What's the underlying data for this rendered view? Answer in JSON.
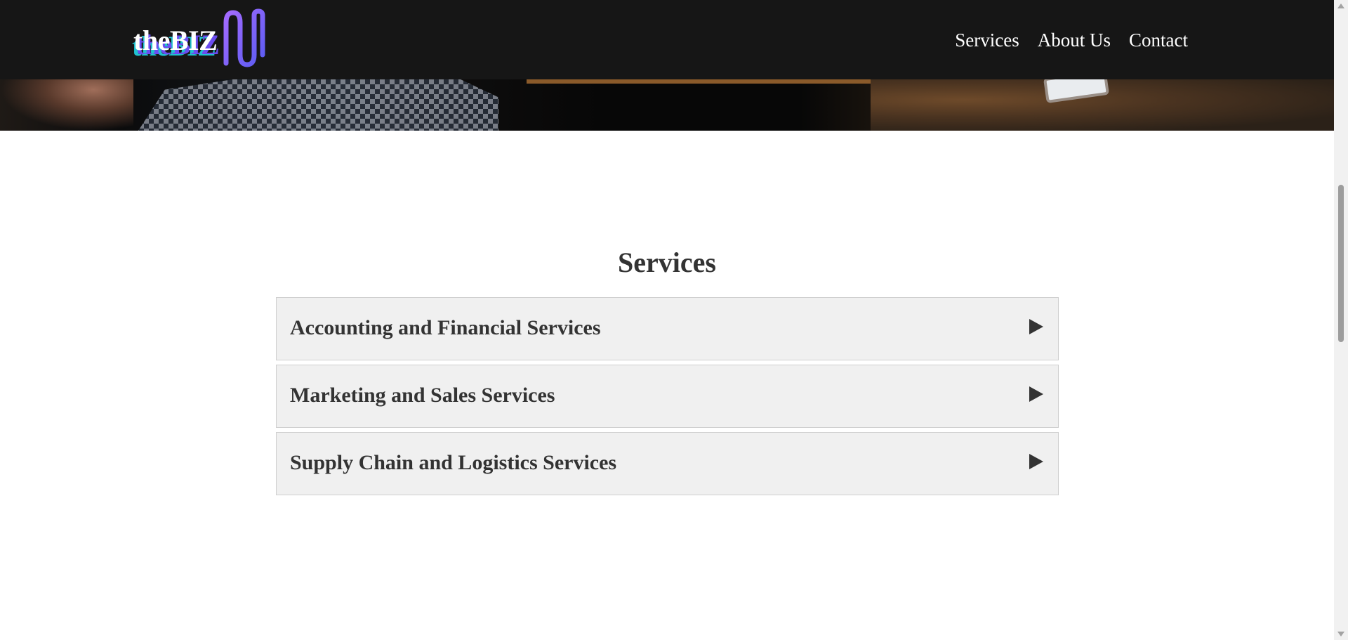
{
  "brand": {
    "logo_text": "theBIZ",
    "logo_alt": "theBIZ logo",
    "accent_colors": [
      "#6b4cf0",
      "#20c2d0",
      "#a56bff"
    ]
  },
  "nav": {
    "links": [
      {
        "label": "Services"
      },
      {
        "label": "About Us"
      },
      {
        "label": "Contact"
      }
    ]
  },
  "services": {
    "title": "Services",
    "items": [
      {
        "label": "Accounting and Financial Services",
        "icon": "triangle-right-icon"
      },
      {
        "label": "Marketing and Sales Services",
        "icon": "triangle-right-icon"
      },
      {
        "label": "Supply Chain and Logistics Services",
        "icon": "triangle-right-icon"
      }
    ]
  },
  "colors": {
    "navbar_bg": "#161616",
    "accordion_bg": "#f0f0f0",
    "text": "#333333"
  }
}
